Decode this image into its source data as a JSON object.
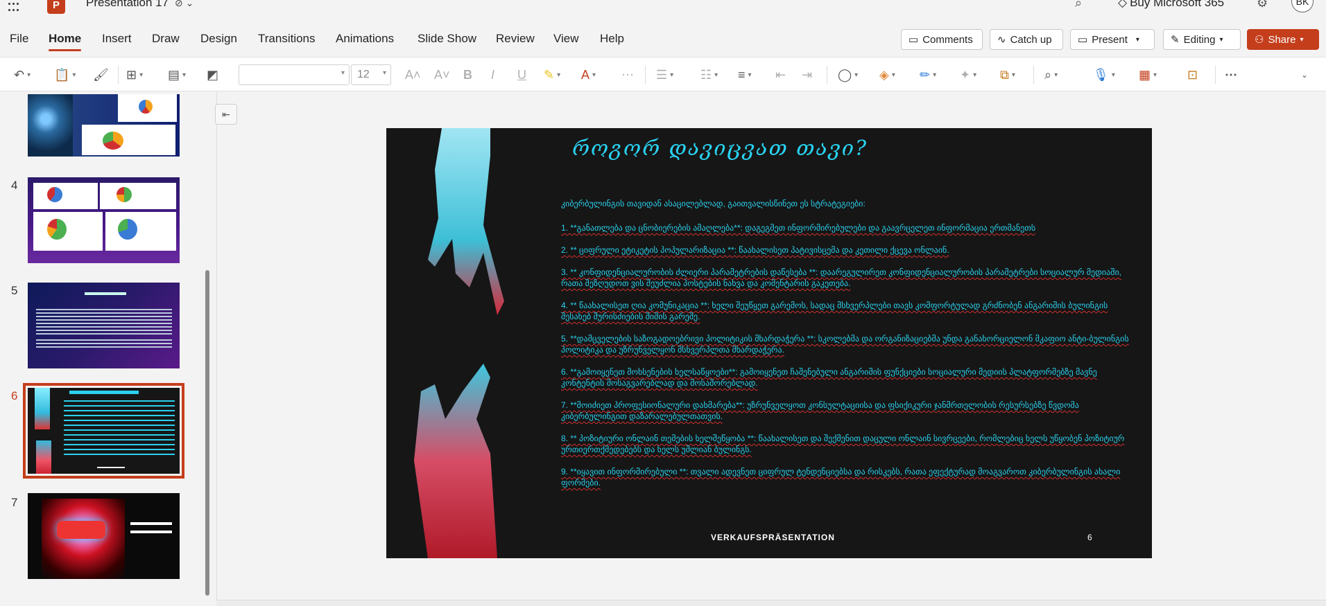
{
  "app": {
    "doc_title": "Presentation 17",
    "buy_label": "Buy Microsoft 365",
    "avatar_initials": "BK",
    "accent": "#c43e1c"
  },
  "menu": {
    "tabs": [
      "File",
      "Home",
      "Insert",
      "Draw",
      "Design",
      "Transitions",
      "Animations",
      "Slide Show",
      "Review",
      "View",
      "Help"
    ],
    "active": "Home"
  },
  "actions": {
    "comments": "Comments",
    "catchup": "Catch up",
    "present": "Present",
    "editing": "Editing",
    "share": "Share"
  },
  "ribbon": {
    "font_size": "12"
  },
  "thumbnails": [
    {
      "number": "4",
      "label": ""
    },
    {
      "number": "5",
      "label": ""
    },
    {
      "number": "6",
      "label": ""
    },
    {
      "number": "7",
      "label": ""
    }
  ],
  "slide": {
    "number": "6",
    "title": "როგორ დავიცვათ თავი?",
    "intro": "კიბერბულინგის თავიდან ასაცილებლად, გაითვალისწინეთ ეს სტრატეგიები:",
    "items": [
      "1. **განათლება და ცნობიერების ამაღლება**: დაგეგმეთ ინფორმირებულები და გაავრცელეთ ინფორმაცია ერთმანეთს",
      "2. ** ციფრული ეტიკეტის პოპულარიზაცია **: წაახალისეთ პატივისცემა და კეთილი ქცევა ონლაინ.",
      "3. ** კონფიდენციალურობის ძლიერი პარამეტრების დაწესება **: დაარეგულირეთ კონფიდენციალურობის პარამეტრები სოციალურ მედიაში, რათა შეზღუდოთ ვის შეუძლია პოსტების ნახვა და კომენტარის გაკეთება.",
      "4. ** წაახალისეთ ღია კომუნიკაცია **: ხელი შეუწყეთ გარემოს, სადაც მსხვერპლები თავს კომფორტულად გრძნობენ ანგარიშის ბულინგის შესახებ შურისძიების შიშის გარეშე.",
      "5. **დამცველების საზოგადოებრივი პოლიტიკის მხარდაჭერა **: სკოლებმა და ორგანიზაციებმა უნდა განახორციელონ მკაფიო ანტი-ბულინგის პოლიტიკა და უზრუნველყონ მსხვერპლთა მხარდაჭერა.",
      "6. **გამოიყენეთ მოხსენების ხელსაწყოები**: გამოიყენეთ ჩაშენებული ანგარიშის ფუნქციები სოციალური მედიის პლატფორმებზე მავნე კონტენტის მოსაგვარებლად და მოსაშორებლად.",
      "7. **მოიძიეთ პროფესიონალური დახმარება**: უზრუნველყოთ კონსულტაციისა და ფსიქიკური ჯანმრთელობის რესურსებზე წვდომა კიბერბულინგით დაზარალებულთათვის.",
      "8. ** პოზიტიური ონლაინ თემების ხელშეწყობა **: წაახალისეთ და შექმენით დაცული ონლაინ სივრცეები, რომლებიც ხელს უწყობენ პოზიტიურ ურთიერთქმედებებს და ხელს უშლიან ბულინგს.",
      "9. **იყავით ინფორმირებული **: თვალი ადევნეთ ციფრულ ტენდენციებსა და რისკებს, რათა ეფექტურად მოაგვაროთ კიბერბულინგის ახალი ფორმები."
    ],
    "footer": "VERKAUFSPRÄSENTATION"
  }
}
